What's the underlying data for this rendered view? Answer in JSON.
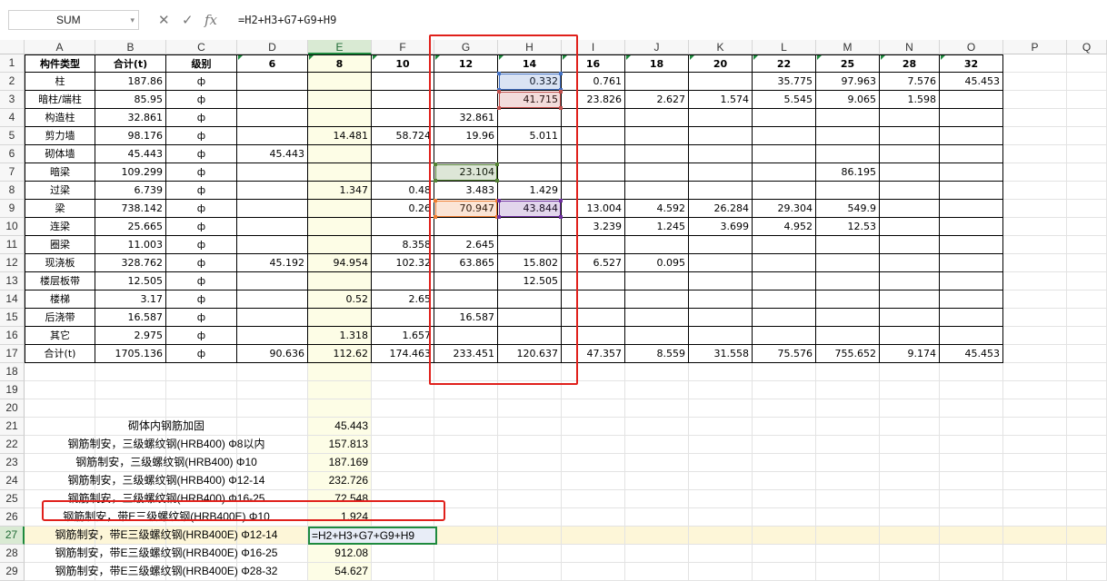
{
  "formula_bar": {
    "name_box": "SUM",
    "cancel_icon": "close-icon",
    "enter_icon": "check-icon",
    "fx_label": "fx",
    "formula": "=H2+H3+G7+G9+H9"
  },
  "columns": [
    "A",
    "B",
    "C",
    "D",
    "E",
    "F",
    "G",
    "H",
    "I",
    "J",
    "K",
    "L",
    "M",
    "N",
    "O",
    "P",
    "Q"
  ],
  "rows": [
    "1",
    "2",
    "3",
    "4",
    "5",
    "6",
    "7",
    "8",
    "9",
    "10",
    "11",
    "12",
    "13",
    "14",
    "15",
    "16",
    "17",
    "18",
    "19",
    "20",
    "21",
    "22",
    "23",
    "24",
    "25",
    "26",
    "27",
    "28",
    "29"
  ],
  "table": {
    "header": [
      "构件类型",
      "合计(t)",
      "级别",
      "6",
      "8",
      "10",
      "12",
      "14",
      "16",
      "18",
      "20",
      "22",
      "25",
      "28",
      "32"
    ],
    "rows": [
      [
        "柱",
        "187.86",
        "ф",
        "",
        "",
        "",
        "",
        "0.332",
        "0.761",
        "",
        "",
        "35.775",
        "97.963",
        "7.576",
        "45.453"
      ],
      [
        "暗柱/端柱",
        "85.95",
        "ф",
        "",
        "",
        "",
        "",
        "41.715",
        "23.826",
        "2.627",
        "1.574",
        "5.545",
        "9.065",
        "1.598",
        ""
      ],
      [
        "构造柱",
        "32.861",
        "ф",
        "",
        "",
        "",
        "32.861",
        "",
        "",
        "",
        "",
        "",
        "",
        "",
        ""
      ],
      [
        "剪力墙",
        "98.176",
        "ф",
        "",
        "14.481",
        "58.724",
        "19.96",
        "5.011",
        "",
        "",
        "",
        "",
        "",
        "",
        ""
      ],
      [
        "砌体墙",
        "45.443",
        "ф",
        "45.443",
        "",
        "",
        "",
        "",
        "",
        "",
        "",
        "",
        "",
        "",
        ""
      ],
      [
        "暗梁",
        "109.299",
        "ф",
        "",
        "",
        "",
        "23.104",
        "",
        "",
        "",
        "",
        "",
        "86.195",
        "",
        ""
      ],
      [
        "过梁",
        "6.739",
        "ф",
        "",
        "1.347",
        "0.48",
        "3.483",
        "1.429",
        "",
        "",
        "",
        "",
        "",
        "",
        ""
      ],
      [
        "梁",
        "738.142",
        "ф",
        "",
        "",
        "0.26",
        "70.947",
        "43.844",
        "13.004",
        "4.592",
        "26.284",
        "29.304",
        "549.9",
        "",
        ""
      ],
      [
        "连梁",
        "25.665",
        "ф",
        "",
        "",
        "",
        "",
        "",
        "3.239",
        "1.245",
        "3.699",
        "4.952",
        "12.53",
        "",
        ""
      ],
      [
        "圈梁",
        "11.003",
        "ф",
        "",
        "",
        "8.358",
        "2.645",
        "",
        "",
        "",
        "",
        "",
        "",
        "",
        ""
      ],
      [
        "现浇板",
        "328.762",
        "ф",
        "45.192",
        "94.954",
        "102.32",
        "63.865",
        "15.802",
        "6.527",
        "0.095",
        "",
        "",
        "",
        "",
        ""
      ],
      [
        "楼层板带",
        "12.505",
        "ф",
        "",
        "",
        "",
        "",
        "12.505",
        "",
        "",
        "",
        "",
        "",
        "",
        ""
      ],
      [
        "楼梯",
        "3.17",
        "ф",
        "",
        "0.52",
        "2.65",
        "",
        "",
        "",
        "",
        "",
        "",
        "",
        "",
        ""
      ],
      [
        "后浇带",
        "16.587",
        "ф",
        "",
        "",
        "",
        "16.587",
        "",
        "",
        "",
        "",
        "",
        "",
        "",
        ""
      ],
      [
        "其它",
        "2.975",
        "ф",
        "",
        "1.318",
        "1.657",
        "",
        "",
        "",
        "",
        "",
        "",
        "",
        "",
        ""
      ],
      [
        "合计(t)",
        "1705.136",
        "ф",
        "90.636",
        "112.62",
        "174.463",
        "233.451",
        "120.637",
        "47.357",
        "8.559",
        "31.558",
        "75.576",
        "755.652",
        "9.174",
        "45.453"
      ]
    ]
  },
  "summary": [
    {
      "label": "砌体内钢筋加固",
      "value": "45.443"
    },
    {
      "label": "钢筋制安，三级螺纹钢(HRB400) Φ8以内",
      "value": "157.813"
    },
    {
      "label": "钢筋制安，三级螺纹钢(HRB400) Φ10",
      "value": "187.169"
    },
    {
      "label": "钢筋制安，三级螺纹钢(HRB400) Φ12-14",
      "value": "232.726"
    },
    {
      "label": "钢筋制安，三级螺纹钢(HRB400) Φ16-25",
      "value": "72.548"
    },
    {
      "label": "钢筋制安，带E三级螺纹钢(HRB400E) Φ10",
      "value": "1.924"
    },
    {
      "label": "钢筋制安，带E三级螺纹钢(HRB400E) Φ12-14",
      "value": "=H2+H3+G7+G9+H9"
    },
    {
      "label": "钢筋制安，带E三级螺纹钢(HRB400E) Φ16-25",
      "value": "912.08"
    },
    {
      "label": "钢筋制安，带E三级螺纹钢(HRB400E) Φ28-32",
      "value": "54.627"
    }
  ],
  "colors": {
    "selected_column": "#fdfde6",
    "selected_header": "#d9ead3",
    "annotation_red": "#e0201b",
    "ref_blue": "#4472c4",
    "ref_red": "#c0504d",
    "ref_green": "#548235",
    "ref_orange": "#ed7d31",
    "ref_purple": "#7030a0"
  }
}
